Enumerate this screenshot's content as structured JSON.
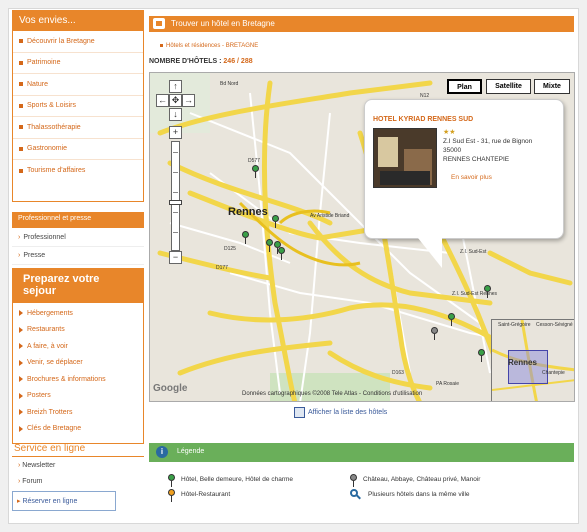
{
  "sidebar": {
    "envies_header": "Vos envies...",
    "envies_items": [
      "Découvrir la Bretagne",
      "Patrimoine",
      "Nature",
      "Sports & Loisirs",
      "Thalassothérapie",
      "Gastronomie",
      "Tourisme d'affaires"
    ],
    "pro_header": "Professionnel et presse",
    "pro_items": [
      "Professionnel",
      "Presse"
    ],
    "prepare_header": "Preparez votre sejour",
    "prepare_items": [
      "Hébergements",
      "Restaurants",
      "A faire, à voir",
      "Venir, se déplacer",
      "Brochures & informations",
      "Posters",
      "Breizh Trotters",
      "Clés de Bretagne"
    ],
    "service_header": "Service en ligne",
    "service_items": [
      "Newsletter",
      "Forum"
    ],
    "reserve_label": "Réserver en ligne"
  },
  "main": {
    "title": "Trouver un hôtel en Bretagne",
    "subtitle": "Hôtels et résidences - BRETAGNE",
    "count_label": "NOMBRE D'HÔTELS :",
    "count_value": "246 / 288",
    "map_types": [
      "Plan",
      "Satellite",
      "Mixte"
    ],
    "list_link": "Afficher la liste des hôtels",
    "legend_title": "Légende"
  },
  "map": {
    "city": "Rennes",
    "labels": [
      "Bd Nord",
      "D577",
      "Av Aristide Briand",
      "D125",
      "D177",
      "D163",
      "Z.I. Sud-Est",
      "Z.I. Sud-Est Rennes",
      "PA Rosaie",
      "Saint-Grégoire",
      "Rennes",
      "Chantepie",
      "Cesson-Sévigné",
      "N12"
    ],
    "copyright": "Données cartographiques ©2008 Tele Atlas - Conditions d'utilisation",
    "google": "Google",
    "popup": {
      "title": "HOTEL KYRIAD RENNES SUD",
      "stars": "★★",
      "address_lines": [
        "Z.I Sud Est - 31, rue de Bignon",
        "35000",
        "RENNES CHANTEPIE"
      ],
      "link": "En savoir plus"
    }
  },
  "legend": {
    "items": [
      "Hôtel, Belle demeure, Hôtel de charme",
      "Hôtel-Restaurant",
      "Château, Abbaye, Château privé, Manoir",
      "Plusieurs hôtels dans la même ville"
    ],
    "colors": {
      "green": "#3aa048",
      "orange": "#f0a020",
      "gray": "#888888",
      "blue": "#2a6aa0"
    }
  }
}
